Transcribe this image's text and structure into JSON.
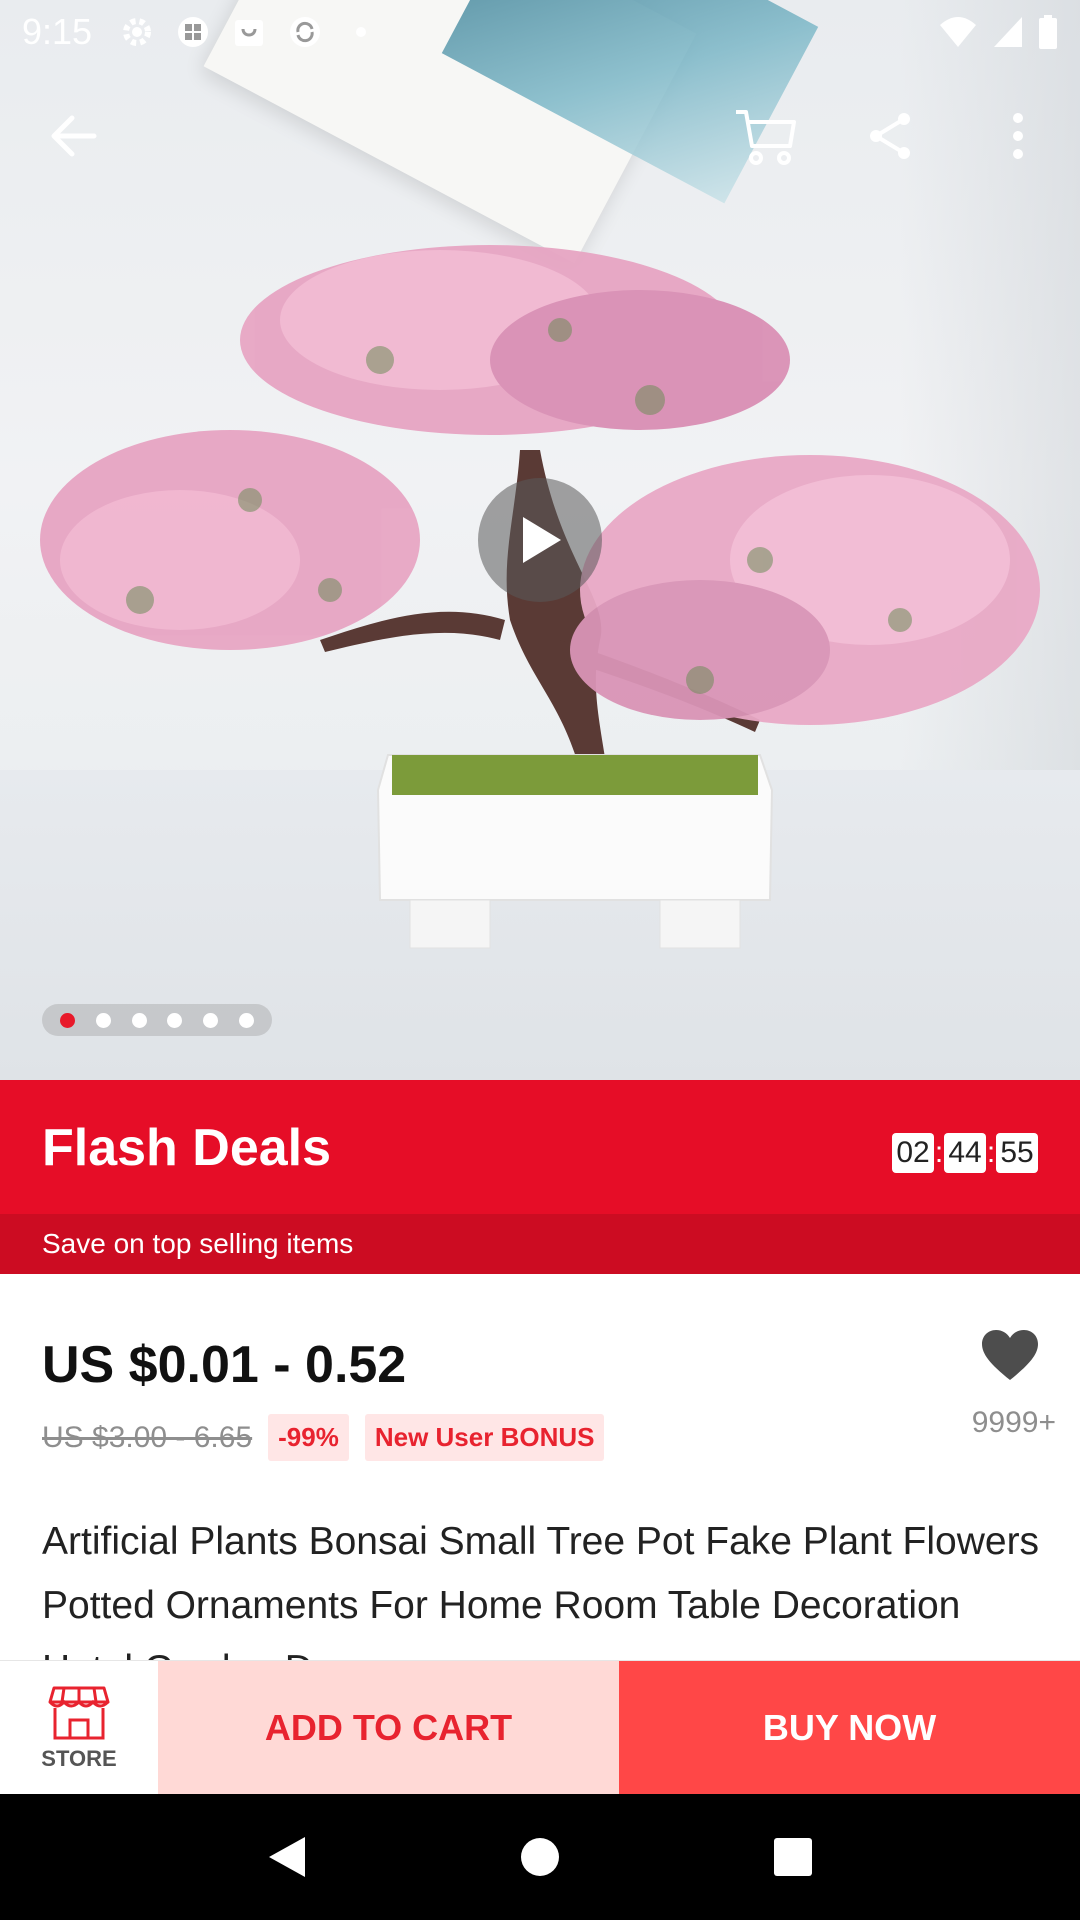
{
  "status_bar": {
    "time": "9:15",
    "icons": [
      "settings-icon",
      "app-grid-icon",
      "shopping-bag-icon",
      "sync-icon",
      "dot-icon"
    ],
    "right_icons": [
      "wifi-icon",
      "cell-signal-icon",
      "battery-icon"
    ]
  },
  "top_bar": {
    "back_icon": "arrow-left-icon",
    "cart_icon": "cart-icon",
    "share_icon": "share-icon",
    "more_icon": "more-vertical-icon"
  },
  "gallery": {
    "image_count": 6,
    "active_index": 0,
    "has_video": true
  },
  "flash_deals": {
    "title": "Flash Deals",
    "timer": {
      "hours": "02",
      "minutes": "44",
      "seconds": "55"
    },
    "subtitle": "Save on top selling items",
    "color": "#e60d27"
  },
  "product": {
    "price": "US $0.01 - 0.52",
    "original_price": "US $3.00 - 6.65",
    "discount": "-99%",
    "bonus_tag": "New User BONUS",
    "wishlist_count": "9999+",
    "title": "Artificial Plants Bonsai Small Tree Pot Fake Plant Flowers Potted Ornaments For Home Room Table Decoration Hotel Garden Decor"
  },
  "bottom_bar": {
    "store_label": "STORE",
    "add_to_cart": "ADD TO CART",
    "buy_now": "BUY NOW",
    "accent": "#ff4747"
  },
  "nav_bar": {
    "icons": [
      "back-triangle-icon",
      "home-circle-icon",
      "recents-square-icon"
    ]
  }
}
